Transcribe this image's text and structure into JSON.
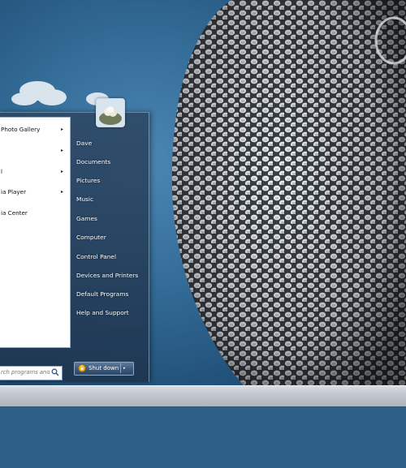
{
  "start_menu": {
    "programs": [
      {
        "label": "Photo Gallery",
        "has_submenu": true
      },
      {
        "label": "",
        "has_submenu": true
      },
      {
        "label": "l",
        "has_submenu": true
      },
      {
        "label": "ia Player",
        "has_submenu": true
      },
      {
        "label": "ia Center",
        "has_submenu": false
      }
    ],
    "search_placeholder": "rch programs and files",
    "right_pane": [
      "Dave",
      "Documents",
      "Pictures",
      "Music",
      "Games",
      "Computer",
      "Control Panel",
      "Devices and Printers",
      "Default Programs",
      "Help and Support"
    ],
    "shutdown_label": "Shut down",
    "arrow_glyph": "▸",
    "dropdown_glyph": "▸"
  },
  "colors": {
    "accent": "#2d4868",
    "desktop": "#346d98"
  }
}
